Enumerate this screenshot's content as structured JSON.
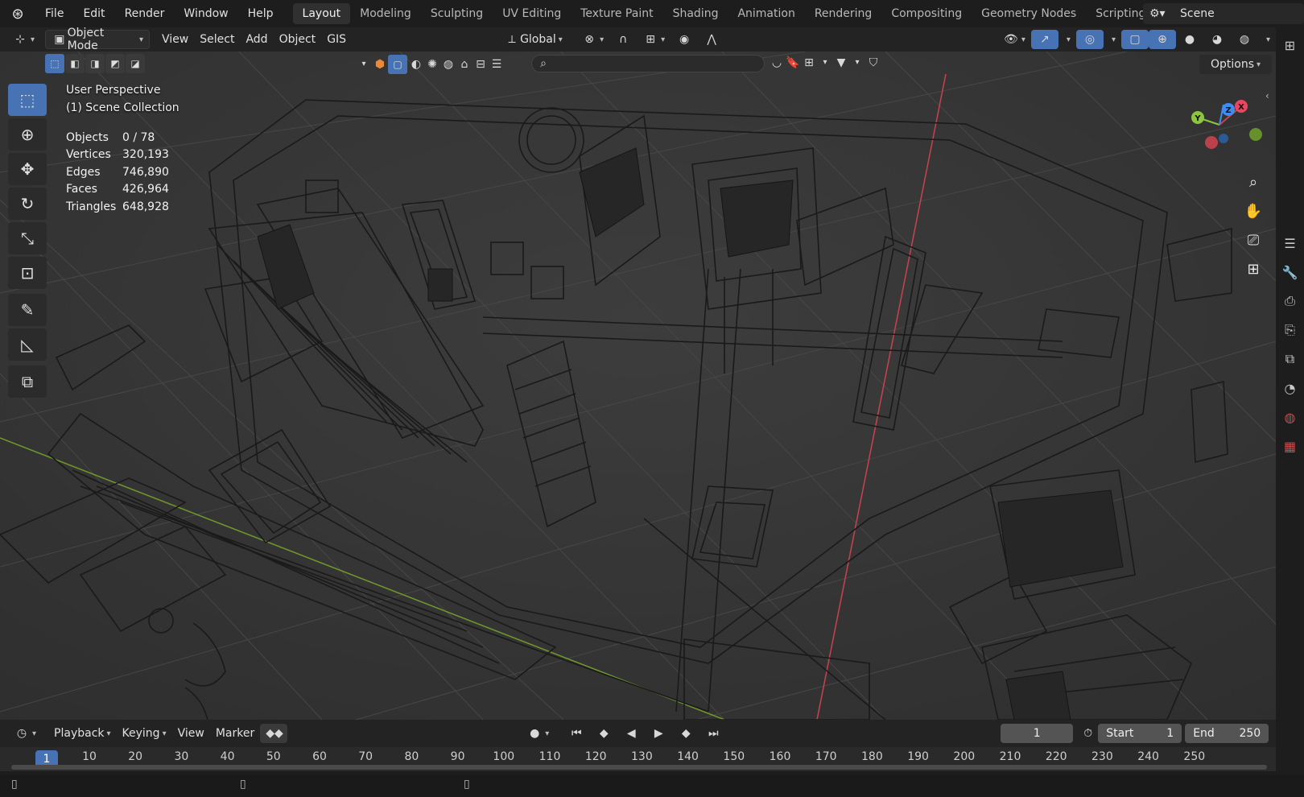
{
  "topbar": {
    "menus": [
      "File",
      "Edit",
      "Render",
      "Window",
      "Help"
    ],
    "workspaces": [
      "Layout",
      "Modeling",
      "Sculpting",
      "UV Editing",
      "Texture Paint",
      "Shading",
      "Animation",
      "Rendering",
      "Compositing",
      "Geometry Nodes",
      "Scripting"
    ],
    "active_workspace": "Layout",
    "scene_name": "Scene"
  },
  "header": {
    "mode": "Object Mode",
    "menus": [
      "View",
      "Select",
      "Add",
      "Object",
      "GIS"
    ],
    "transform_orientation": "Global",
    "options_label": "Options"
  },
  "viewport": {
    "perspective_label": "User Perspective",
    "collection_label": "(1) Scene Collection",
    "stats": [
      {
        "label": "Objects",
        "value": "0 / 78"
      },
      {
        "label": "Vertices",
        "value": "320,193"
      },
      {
        "label": "Edges",
        "value": "746,890"
      },
      {
        "label": "Faces",
        "value": "426,964"
      },
      {
        "label": "Triangles",
        "value": "648,928"
      }
    ],
    "gizmo_axes": [
      "X",
      "Y",
      "Z"
    ]
  },
  "timeline": {
    "menus": [
      "Playback",
      "Keying",
      "View",
      "Marker"
    ],
    "current_frame": "1",
    "start_label": "Start",
    "start_value": "1",
    "end_label": "End",
    "end_value": "250",
    "ruler_marks": [
      "1",
      "10",
      "20",
      "30",
      "40",
      "50",
      "60",
      "70",
      "80",
      "90",
      "100",
      "110",
      "120",
      "130",
      "140",
      "150",
      "160",
      "170",
      "180",
      "190",
      "200",
      "210",
      "220",
      "230",
      "240",
      "250"
    ]
  },
  "colors": {
    "accent": "#4772b3",
    "x_axis": "#e8485f",
    "y_axis": "#8cc63f",
    "z_axis": "#3d8ef0"
  }
}
